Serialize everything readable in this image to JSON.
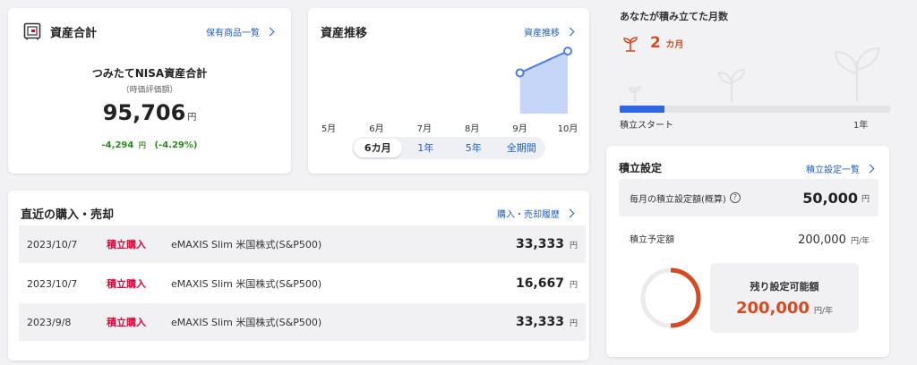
{
  "assets": {
    "title": "資産合計",
    "link": "保有商品一覧",
    "label": "つみたてNISA資産合計",
    "sublabel": "（時価評価額）",
    "amount": "95,706",
    "unit": "円",
    "change": "-4,294",
    "change_unit": "円",
    "change_pct": "(-4.29%)"
  },
  "trend": {
    "title": "資産推移",
    "link": "資産推移",
    "months": [
      "5月",
      "6月",
      "7月",
      "8月",
      "9月",
      "10月"
    ],
    "tabs": [
      "6カ月",
      "1年",
      "5年",
      "全期間"
    ],
    "active_tab": "6カ月"
  },
  "chart_data": {
    "type": "area",
    "categories": [
      "5月",
      "6月",
      "7月",
      "8月",
      "9月",
      "10月"
    ],
    "series": [
      {
        "values": [
          null,
          null,
          null,
          null,
          62373,
          95706
        ]
      }
    ],
    "ylim": [
      0,
      100000
    ],
    "grid": false,
    "fill_color": "#c6d6f8",
    "line_color": "#4d7ce8"
  },
  "months_card": {
    "title": "あなたが積み立てた月数",
    "count": "2",
    "unit": "カ月",
    "start_label": "積立スタート",
    "end_label": "1年",
    "progress": 0.1667,
    "progress_color": "#2f66e3"
  },
  "trades": {
    "title": "直近の購入・売却",
    "link": "購入・売却履歴",
    "rows": [
      {
        "date": "2023/10/7",
        "type": "積立購入",
        "fund": "eMAXIS Slim 米国株式(S&P500)",
        "amount": "33,333",
        "unit": "円"
      },
      {
        "date": "2023/10/7",
        "type": "積立購入",
        "fund": "eMAXIS Slim 米国株式(S&P500)",
        "amount": "16,667",
        "unit": "円"
      },
      {
        "date": "2023/9/8",
        "type": "積立購入",
        "fund": "eMAXIS Slim 米国株式(S&P500)",
        "amount": "33,333",
        "unit": "円"
      }
    ]
  },
  "settings": {
    "title": "積立設定",
    "link": "積立設定一覧",
    "monthly_label": "毎月の積立設定額(概算)",
    "monthly_amount": "50,000",
    "monthly_unit": "円",
    "planned_label": "積立予定額",
    "planned_amount": "200,000",
    "planned_unit": "円/年",
    "remaining_label": "残り設定可能額",
    "remaining_amount": "200,000",
    "remaining_unit": "円/年",
    "used_fraction": 0.5,
    "ring_color": "#d9491f"
  }
}
